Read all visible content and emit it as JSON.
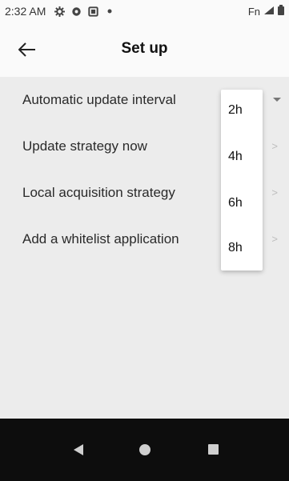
{
  "status_bar": {
    "time": "2:32 AM",
    "left_icons": [
      "gear-icon",
      "vpn-key-icon",
      "sim-card-icon",
      "dot-icon"
    ],
    "right_text": "Fn",
    "right_icons": [
      "signal-icon",
      "battery-icon"
    ]
  },
  "app_bar": {
    "title": "Set up",
    "back_icon": "back-arrow-icon"
  },
  "settings": {
    "items": [
      {
        "label": "Automatic update interval",
        "trailing": "dropdown"
      },
      {
        "label": "Update strategy now",
        "trailing": "chevron"
      },
      {
        "label": "Local acquisition strategy",
        "trailing": "chevron"
      },
      {
        "label": "Add a whitelist application",
        "trailing": "chevron"
      }
    ],
    "chevron_glyph": ">"
  },
  "interval_popup": {
    "options": [
      "2h",
      "4h",
      "6h",
      "8h"
    ]
  },
  "nav_bar": {
    "buttons": [
      "nav-back-icon",
      "nav-home-icon",
      "nav-recents-icon"
    ]
  },
  "colors": {
    "background": "#ececec",
    "bar": "#fafafa",
    "nav": "#0d0d0d"
  }
}
